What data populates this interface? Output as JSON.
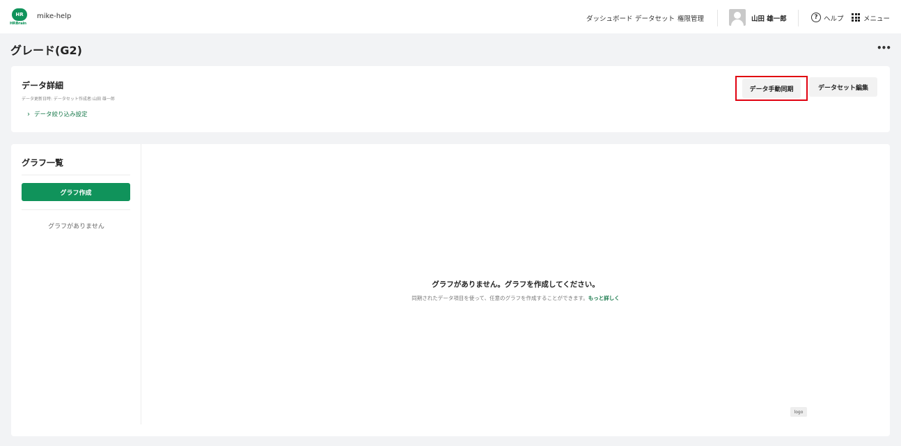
{
  "header": {
    "logo_mark": "HR",
    "logo_text": "HRBrain",
    "workspace": "mike-help",
    "nav": {
      "dashboard": "ダッシュボード",
      "dataset": "データセット",
      "permissions": "権限管理"
    },
    "user_name": "山田 雄一郎",
    "help_label": "ヘルプ",
    "menu_label": "メニュー"
  },
  "page": {
    "title": "グレード(G2)",
    "more_label": "•••"
  },
  "detail": {
    "title": "データ詳細",
    "meta": "データ更新日時: データセット作成者:山田 雄一郎",
    "filter_link": "データ絞り込み設定",
    "sync_button": "データ手動同期",
    "edit_button": "データセット編集"
  },
  "graphs": {
    "list_title": "グラフ一覧",
    "create_button": "グラフ作成",
    "empty_side": "グラフがありません",
    "empty_title": "グラフがありません。グラフを作成してください。",
    "empty_desc": "同期されたデータ項目を使って、任意のグラフを作成することができます。",
    "more_link": "もっと詳しく",
    "logo_badge": "logo"
  },
  "colors": {
    "brand_green": "#10935b",
    "highlight_red": "#e0000f",
    "background": "#f2f3f5"
  }
}
